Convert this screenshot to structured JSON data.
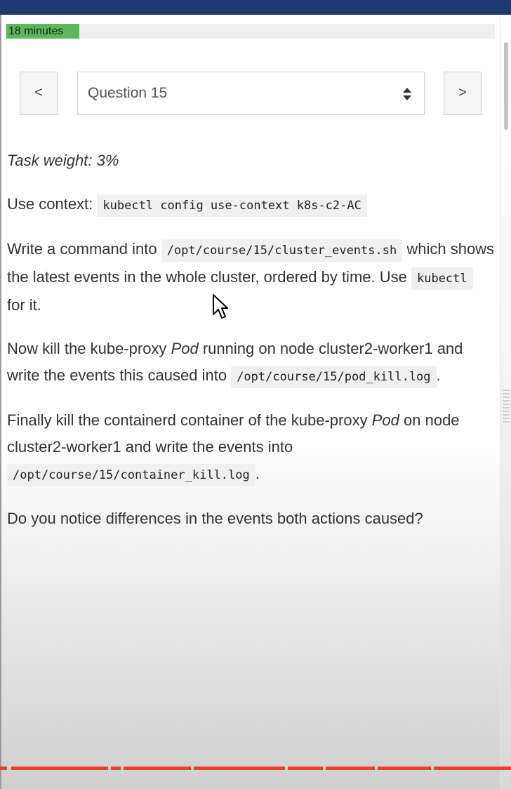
{
  "timer": {
    "label": "18 minutes",
    "progress_percent": 15
  },
  "nav": {
    "prev_label": "<",
    "next_label": ">",
    "question_select": "Question 15"
  },
  "question": {
    "task_weight": "Task weight: 3%",
    "context_prefix": "Use context:",
    "context_command": "kubectl config use-context k8s-c2-AC",
    "write_prefix": "Write a command into",
    "write_file": "/opt/course/15/cluster_events.sh",
    "write_middle": "which shows the latest events in the whole cluster, ordered by time. Use",
    "write_tool": "kubectl",
    "write_suffix": "for it.",
    "kill_prefix": "Now kill the kube-proxy",
    "kill_pod": "Pod",
    "kill_middle": "running on node cluster2-worker1 and write the events this caused into",
    "kill_file": "/opt/course/15/pod_kill.log",
    "period": ".",
    "final_prefix": "Finally kill the containerd container of the kube-proxy",
    "final_pod": "Pod",
    "final_middle": "on node cluster2-worker1 and write the events into",
    "final_file": "/opt/course/15/container_kill.log",
    "closing": "Do you notice differences in the events both actions caused?"
  },
  "colors": {
    "topbar": "#1f3a6e",
    "timer_fill": "#5cb85c",
    "progress_line": "#e8412c"
  },
  "icons": [
    "sort-arrows-icon",
    "mouse-cursor-icon"
  ]
}
